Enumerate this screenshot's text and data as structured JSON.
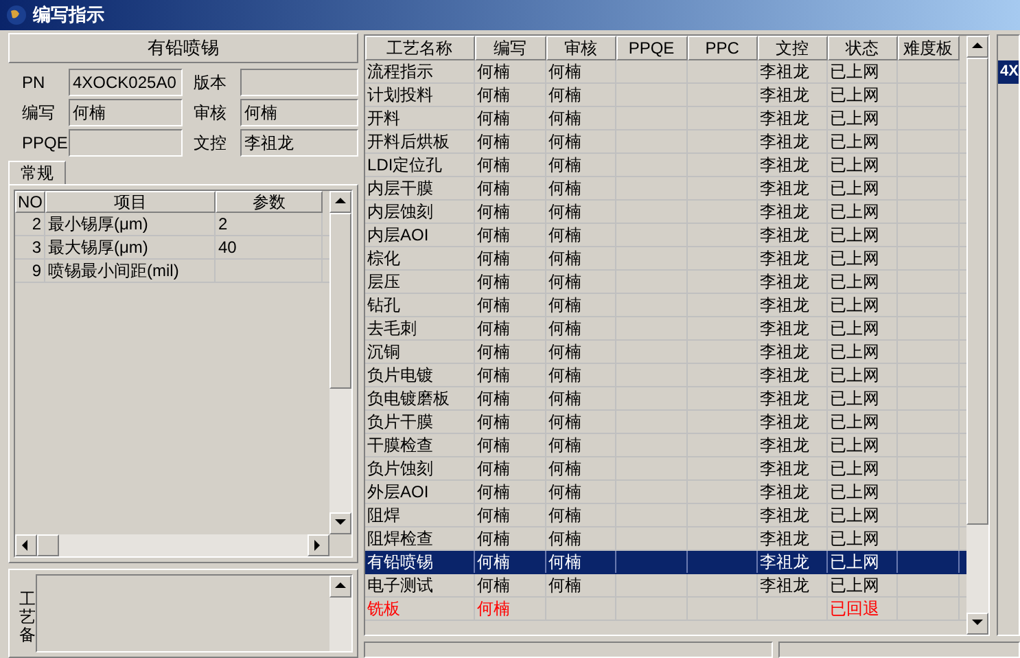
{
  "window": {
    "title": "编写指示"
  },
  "header": {
    "title": "有铅喷锡"
  },
  "fields": [
    {
      "label": "PN",
      "value": "4XOCK025A0"
    },
    {
      "label": "版本"
    },
    {
      "label": "编写",
      "value": "何楠"
    },
    {
      "label": "审核",
      "value": "何楠"
    },
    {
      "label": "PPQE"
    },
    {
      "label": "文控",
      "value": "李祖龙"
    }
  ],
  "tabs": [
    {
      "label": "常规",
      "selected": true
    }
  ],
  "params": {
    "columns": [
      "NO",
      "项目",
      "参数"
    ],
    "rows": [
      [
        "2",
        "最小锡厚(μm)",
        "2"
      ],
      [
        "3",
        "最大锡厚(μm)",
        "40"
      ],
      [
        "9",
        "喷锡最小间距(mil)",
        ""
      ]
    ]
  },
  "memo": {
    "label": "工艺备"
  },
  "process_table": {
    "columns": [
      "工艺名称",
      "编写",
      "审核",
      "PPQE",
      "PPC",
      "文控",
      "状态",
      "难度板"
    ],
    "rows": [
      {
        "cells": [
          "流程指示",
          "何楠",
          "何楠",
          "",
          "",
          "李祖龙",
          "已上网",
          ""
        ],
        "selected": false,
        "returned": false
      },
      {
        "cells": [
          "计划投料",
          "何楠",
          "何楠",
          "",
          "",
          "李祖龙",
          "已上网",
          ""
        ],
        "selected": false,
        "returned": false
      },
      {
        "cells": [
          "开料",
          "何楠",
          "何楠",
          "",
          "",
          "李祖龙",
          "已上网",
          ""
        ],
        "selected": false,
        "returned": false
      },
      {
        "cells": [
          "开料后烘板",
          "何楠",
          "何楠",
          "",
          "",
          "李祖龙",
          "已上网",
          ""
        ],
        "selected": false,
        "returned": false
      },
      {
        "cells": [
          "LDI定位孔",
          "何楠",
          "何楠",
          "",
          "",
          "李祖龙",
          "已上网",
          ""
        ],
        "selected": false,
        "returned": false
      },
      {
        "cells": [
          "内层干膜",
          "何楠",
          "何楠",
          "",
          "",
          "李祖龙",
          "已上网",
          ""
        ],
        "selected": false,
        "returned": false
      },
      {
        "cells": [
          "内层蚀刻",
          "何楠",
          "何楠",
          "",
          "",
          "李祖龙",
          "已上网",
          ""
        ],
        "selected": false,
        "returned": false
      },
      {
        "cells": [
          "内层AOI",
          "何楠",
          "何楠",
          "",
          "",
          "李祖龙",
          "已上网",
          ""
        ],
        "selected": false,
        "returned": false
      },
      {
        "cells": [
          "棕化",
          "何楠",
          "何楠",
          "",
          "",
          "李祖龙",
          "已上网",
          ""
        ],
        "selected": false,
        "returned": false
      },
      {
        "cells": [
          "层压",
          "何楠",
          "何楠",
          "",
          "",
          "李祖龙",
          "已上网",
          ""
        ],
        "selected": false,
        "returned": false
      },
      {
        "cells": [
          "钻孔",
          "何楠",
          "何楠",
          "",
          "",
          "李祖龙",
          "已上网",
          ""
        ],
        "selected": false,
        "returned": false
      },
      {
        "cells": [
          "去毛刺",
          "何楠",
          "何楠",
          "",
          "",
          "李祖龙",
          "已上网",
          ""
        ],
        "selected": false,
        "returned": false
      },
      {
        "cells": [
          "沉铜",
          "何楠",
          "何楠",
          "",
          "",
          "李祖龙",
          "已上网",
          ""
        ],
        "selected": false,
        "returned": false
      },
      {
        "cells": [
          "负片电镀",
          "何楠",
          "何楠",
          "",
          "",
          "李祖龙",
          "已上网",
          ""
        ],
        "selected": false,
        "returned": false
      },
      {
        "cells": [
          "负电镀磨板",
          "何楠",
          "何楠",
          "",
          "",
          "李祖龙",
          "已上网",
          ""
        ],
        "selected": false,
        "returned": false
      },
      {
        "cells": [
          "负片干膜",
          "何楠",
          "何楠",
          "",
          "",
          "李祖龙",
          "已上网",
          ""
        ],
        "selected": false,
        "returned": false
      },
      {
        "cells": [
          "干膜检查",
          "何楠",
          "何楠",
          "",
          "",
          "李祖龙",
          "已上网",
          ""
        ],
        "selected": false,
        "returned": false
      },
      {
        "cells": [
          "负片蚀刻",
          "何楠",
          "何楠",
          "",
          "",
          "李祖龙",
          "已上网",
          ""
        ],
        "selected": false,
        "returned": false
      },
      {
        "cells": [
          "外层AOI",
          "何楠",
          "何楠",
          "",
          "",
          "李祖龙",
          "已上网",
          ""
        ],
        "selected": false,
        "returned": false
      },
      {
        "cells": [
          "阻焊",
          "何楠",
          "何楠",
          "",
          "",
          "李祖龙",
          "已上网",
          ""
        ],
        "selected": false,
        "returned": false
      },
      {
        "cells": [
          "阻焊检查",
          "何楠",
          "何楠",
          "",
          "",
          "李祖龙",
          "已上网",
          ""
        ],
        "selected": false,
        "returned": false
      },
      {
        "cells": [
          "有铅喷锡",
          "何楠",
          "何楠",
          "",
          "",
          "李祖龙",
          "已上网",
          ""
        ],
        "selected": true,
        "returned": false
      },
      {
        "cells": [
          "电子测试",
          "何楠",
          "何楠",
          "",
          "",
          "李祖龙",
          "已上网",
          ""
        ],
        "selected": false,
        "returned": false
      },
      {
        "cells": [
          "铣板",
          "何楠",
          "",
          "",
          "",
          "",
          "已回退",
          ""
        ],
        "selected": false,
        "returned": true
      }
    ]
  },
  "side_list": {
    "rows": [
      {
        "text": "4X",
        "selected": true
      }
    ]
  }
}
